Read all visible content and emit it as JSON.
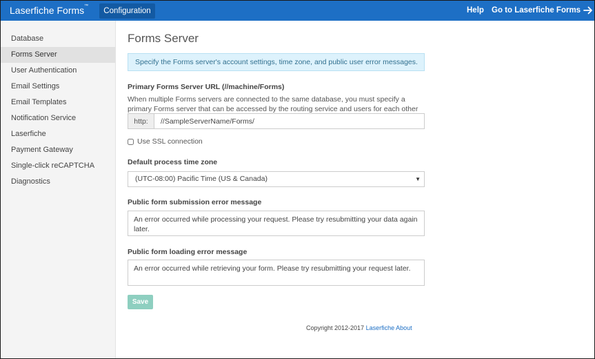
{
  "header": {
    "brand": "Laserfiche Forms",
    "brand_mark": "™",
    "nav_config": "Configuration",
    "help": "Help",
    "goto": "Go to Laserfiche Forms"
  },
  "sidebar": {
    "items": [
      {
        "label": "Database"
      },
      {
        "label": "Forms Server"
      },
      {
        "label": "User Authentication"
      },
      {
        "label": "Email Settings"
      },
      {
        "label": "Email Templates"
      },
      {
        "label": "Notification Service"
      },
      {
        "label": "Laserfiche"
      },
      {
        "label": "Payment Gateway"
      },
      {
        "label": "Single-click reCAPTCHA"
      },
      {
        "label": "Diagnostics"
      }
    ],
    "active_index": 1
  },
  "main": {
    "title": "Forms Server",
    "info": "Specify the Forms server's account settings, time zone, and public user error messages.",
    "url_label": "Primary Forms Server URL (//machine/Forms)",
    "url_help": "When multiple Forms servers are connected to the same database, you must specify a primary Forms server that can be accessed by the routing service and users for each other Forms server.",
    "url_prefix": "http:",
    "url_value": "//SampleServerName/Forms/",
    "ssl_label": "Use SSL connection",
    "tz_label": "Default process time zone",
    "tz_value": "(UTC-08:00) Pacific Time (US & Canada)",
    "submit_err_label": "Public form submission error message",
    "submit_err_value": "An error occurred while processing your request. Please try resubmitting your data again later.",
    "load_err_label": "Public form loading error message",
    "load_err_value": "An error occurred while retrieving your form. Please try resubmitting your request later.",
    "save": "Save"
  },
  "footer": {
    "copyright": "Copyright 2012-2017",
    "link1": "Laserfiche",
    "link2": "About"
  },
  "colors": {
    "topbar": "#1d6fc5",
    "save": "#8ecfc0",
    "info_bg": "#ddf2fc"
  }
}
